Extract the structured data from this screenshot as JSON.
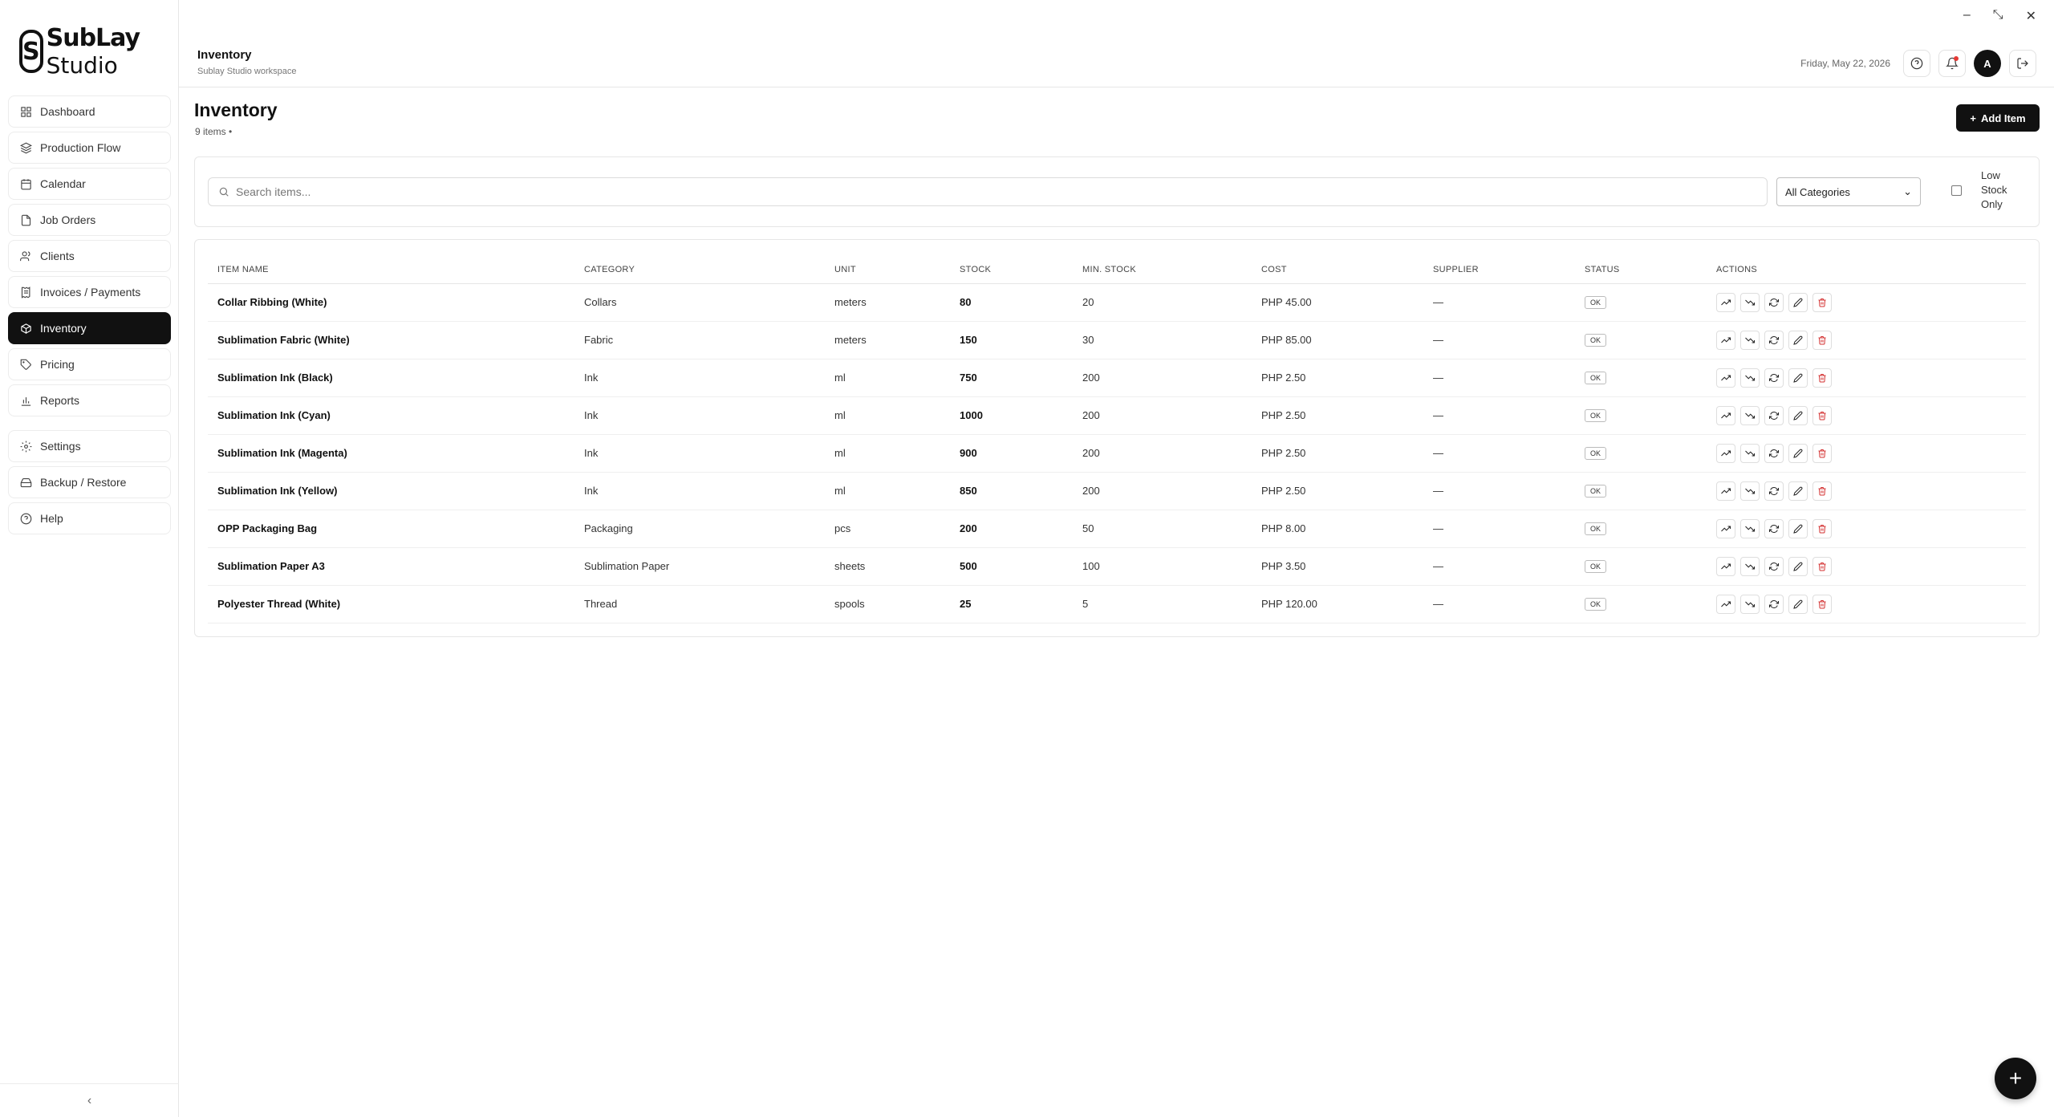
{
  "app": {
    "logo_line1": "SubLay",
    "logo_line2": "Studio",
    "logo_mark": "S"
  },
  "window_controls": [
    "–",
    "⤡",
    "✕"
  ],
  "sidebar": {
    "items": [
      {
        "label": "Dashboard",
        "icon": "grid-icon"
      },
      {
        "label": "Production Flow",
        "icon": "layers-icon"
      },
      {
        "label": "Calendar",
        "icon": "calendar-icon"
      },
      {
        "label": "Job Orders",
        "icon": "document-icon"
      },
      {
        "label": "Clients",
        "icon": "users-icon"
      },
      {
        "label": "Invoices / Payments",
        "icon": "receipt-icon"
      },
      {
        "label": "Inventory",
        "icon": "package-icon",
        "active": true
      },
      {
        "label": "Pricing",
        "icon": "tag-icon"
      },
      {
        "label": "Reports",
        "icon": "bar-chart-icon"
      }
    ],
    "secondary_items": [
      {
        "label": "Settings",
        "icon": "gear-icon"
      },
      {
        "label": "Backup / Restore",
        "icon": "hard-drive-icon"
      },
      {
        "label": "Help",
        "icon": "help-circle-icon"
      }
    ],
    "collapse_label": "‹"
  },
  "header": {
    "title": "Inventory",
    "subtitle": "Sublay Studio workspace",
    "date": "Friday, May 22, 2026",
    "avatar_initial": "A"
  },
  "main": {
    "title": "Inventory",
    "count": "9 items •",
    "add_button": "Add Item",
    "search_placeholder": "Search items...",
    "category_select": "All Categories",
    "low_stock_label": "Low Stock Only"
  },
  "table": {
    "columns": [
      "ITEM NAME",
      "CATEGORY",
      "UNIT",
      "STOCK",
      "MIN. STOCK",
      "COST",
      "SUPPLIER",
      "STATUS",
      "ACTIONS"
    ],
    "rows": [
      {
        "name": "Collar Ribbing (White)",
        "category": "Collars",
        "unit": "meters",
        "stock": "80",
        "min": "20",
        "cost": "PHP 45.00",
        "supplier": "—",
        "status": "OK"
      },
      {
        "name": "Sublimation Fabric (White)",
        "category": "Fabric",
        "unit": "meters",
        "stock": "150",
        "min": "30",
        "cost": "PHP 85.00",
        "supplier": "—",
        "status": "OK"
      },
      {
        "name": "Sublimation Ink (Black)",
        "category": "Ink",
        "unit": "ml",
        "stock": "750",
        "min": "200",
        "cost": "PHP 2.50",
        "supplier": "—",
        "status": "OK"
      },
      {
        "name": "Sublimation Ink (Cyan)",
        "category": "Ink",
        "unit": "ml",
        "stock": "1000",
        "min": "200",
        "cost": "PHP 2.50",
        "supplier": "—",
        "status": "OK"
      },
      {
        "name": "Sublimation Ink (Magenta)",
        "category": "Ink",
        "unit": "ml",
        "stock": "900",
        "min": "200",
        "cost": "PHP 2.50",
        "supplier": "—",
        "status": "OK"
      },
      {
        "name": "Sublimation Ink (Yellow)",
        "category": "Ink",
        "unit": "ml",
        "stock": "850",
        "min": "200",
        "cost": "PHP 2.50",
        "supplier": "—",
        "status": "OK"
      },
      {
        "name": "OPP Packaging Bag",
        "category": "Packaging",
        "unit": "pcs",
        "stock": "200",
        "min": "50",
        "cost": "PHP 8.00",
        "supplier": "—",
        "status": "OK"
      },
      {
        "name": "Sublimation Paper A3",
        "category": "Sublimation Paper",
        "unit": "sheets",
        "stock": "500",
        "min": "100",
        "cost": "PHP 3.50",
        "supplier": "—",
        "status": "OK"
      },
      {
        "name": "Polyester Thread (White)",
        "category": "Thread",
        "unit": "spools",
        "stock": "25",
        "min": "5",
        "cost": "PHP 120.00",
        "supplier": "—",
        "status": "OK"
      }
    ],
    "row_actions": [
      "stock-in-icon",
      "stock-out-icon",
      "adjust-icon",
      "edit-icon",
      "delete-icon"
    ]
  },
  "fab_label": "+"
}
